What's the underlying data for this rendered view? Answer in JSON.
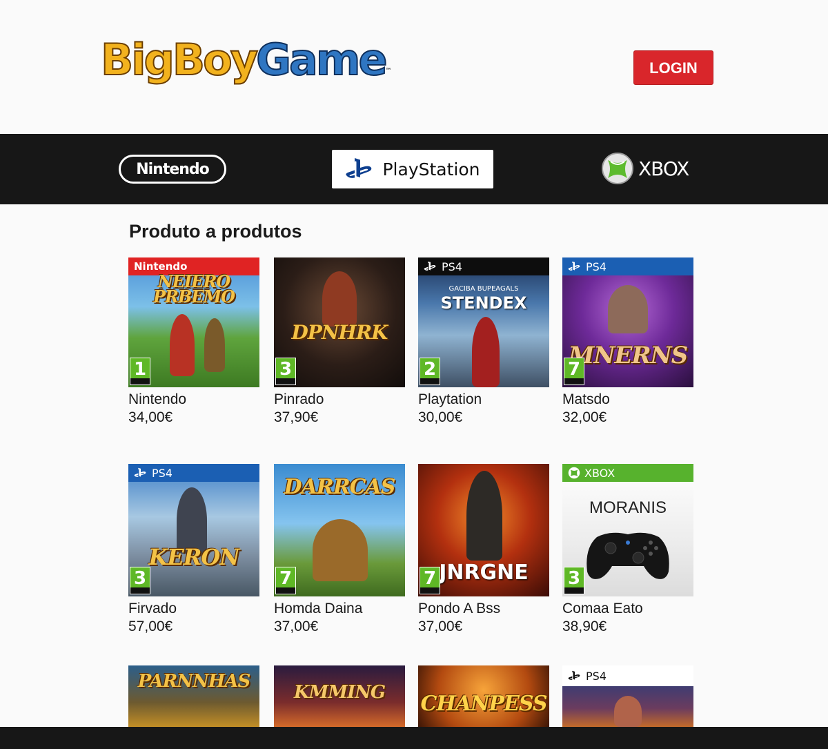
{
  "header": {
    "logo_part1": "BigBoy",
    "logo_part2": "Game",
    "logo_tm": "™",
    "login_label": "LOGIN"
  },
  "platforms": {
    "nintendo": "Nintendo",
    "playstation": "PlayStation",
    "xbox": "XBOX",
    "active": "PlayStation"
  },
  "section": {
    "title": "Produto a produtos"
  },
  "products": [
    {
      "name": "Nintendo",
      "price": "34,00€",
      "banner": "Nintendo",
      "cover_title": "NEIERO PRBEMO",
      "pegi": "1"
    },
    {
      "name": "Pinrado",
      "price": "37,90€",
      "banner": "",
      "cover_title": "DPNHRK",
      "pegi": "3"
    },
    {
      "name": "Playtation",
      "price": "30,00€",
      "banner": "PS4",
      "cover_title": "STENDEX",
      "cover_subtitle": "GACIBA BUPEAGALS",
      "pegi": "2"
    },
    {
      "name": "Matsdo",
      "price": "32,00€",
      "banner": "PS4",
      "cover_title": "MNERNS",
      "pegi": "7"
    },
    {
      "name": "Firvado",
      "price": "57,00€",
      "banner": "PS4",
      "cover_title": "KERON",
      "pegi": "3"
    },
    {
      "name": "Homda Daina",
      "price": "37,00€",
      "banner": "",
      "cover_title": "DARRCAS",
      "pegi": "7"
    },
    {
      "name": "Pondo A Bss",
      "price": "37,00€",
      "banner": "",
      "cover_title": "JNRGNE",
      "pegi": "7"
    },
    {
      "name": "Comaa Eato",
      "price": "38,90€",
      "banner": "XBOX",
      "cover_title": "MORANIS",
      "pegi": "3"
    },
    {
      "name": "",
      "price": "",
      "banner": "",
      "cover_title": "PARNNHAS"
    },
    {
      "name": "",
      "price": "",
      "banner": "",
      "cover_title": "KMMING"
    },
    {
      "name": "",
      "price": "",
      "banner": "",
      "cover_title": "CHANPESS"
    },
    {
      "name": "",
      "price": "",
      "banner": "PS4",
      "cover_title": ""
    }
  ],
  "colors": {
    "login_bg": "#d9262b",
    "nav_bg": "#171717",
    "pegi_green": "#5fb826",
    "nintendo_red": "#e02323",
    "ps_blue": "#1b5fb3",
    "xbox_green": "#57b22d"
  },
  "icons": {
    "playstation": "playstation-logo-icon",
    "xbox": "xbox-sphere-icon",
    "controller": "gamepad-icon"
  }
}
